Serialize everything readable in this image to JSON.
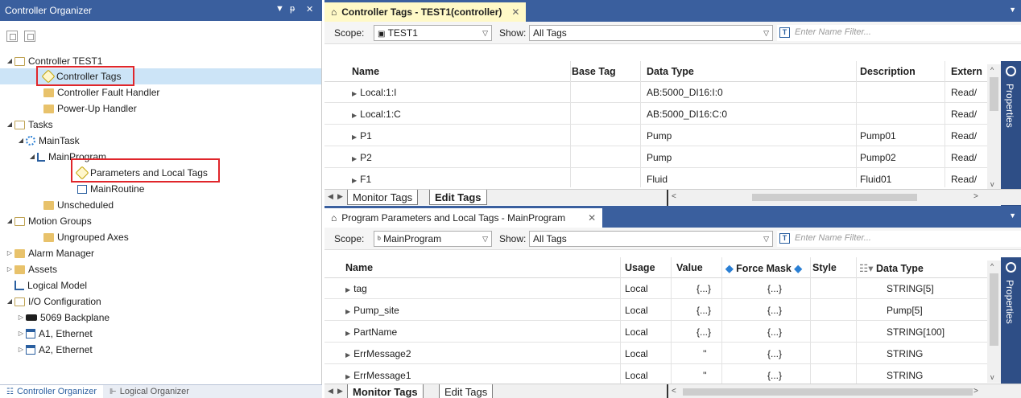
{
  "organizer": {
    "title": "Controller Organizer",
    "pin_glyph": "▾ ᵽ ✕",
    "tree": [
      {
        "label": "Controller TEST1",
        "icon": "folder-open-icon",
        "expand": "◢"
      },
      {
        "label": "Controller Tags",
        "icon": "tag-icon",
        "expand": ""
      },
      {
        "label": "Controller Fault Handler",
        "icon": "folder-icon",
        "expand": ""
      },
      {
        "label": "Power-Up Handler",
        "icon": "folder-icon",
        "expand": ""
      },
      {
        "label": "Tasks",
        "icon": "folder-open-icon",
        "expand": "◢"
      },
      {
        "label": "MainTask",
        "icon": "sync-icon",
        "expand": "◢"
      },
      {
        "label": "MainProgram",
        "icon": "program-icon",
        "expand": "◢"
      },
      {
        "label": "Parameters and Local Tags",
        "icon": "tag-icon",
        "expand": ""
      },
      {
        "label": "MainRoutine",
        "icon": "routine-icon",
        "expand": ""
      },
      {
        "label": "Unscheduled",
        "icon": "folder-icon",
        "expand": ""
      },
      {
        "label": "Motion Groups",
        "icon": "folder-open-icon",
        "expand": "◢"
      },
      {
        "label": "Ungrouped Axes",
        "icon": "folder-icon",
        "expand": ""
      },
      {
        "label": "Alarm Manager",
        "icon": "folder-icon",
        "expand": "▷"
      },
      {
        "label": "Assets",
        "icon": "folder-icon",
        "expand": "▷"
      },
      {
        "label": "Logical Model",
        "icon": "logical-model-icon",
        "expand": ""
      },
      {
        "label": "I/O Configuration",
        "icon": "folder-open-icon",
        "expand": "◢"
      },
      {
        "label": "5069 Backplane",
        "icon": "backplane-icon",
        "expand": "▷"
      },
      {
        "label": "A1, Ethernet",
        "icon": "ethernet-icon",
        "expand": "▷"
      },
      {
        "label": "A2, Ethernet",
        "icon": "ethernet-icon",
        "expand": "▷"
      }
    ],
    "bottom_tabs": [
      "Controller Organizer",
      "Logical Organizer"
    ]
  },
  "top_panel": {
    "tab_label": "Controller Tags - TEST1(controller)",
    "scope_label": "Scope:",
    "scope_value": "TEST1",
    "show_label": "Show:",
    "show_value": "All Tags",
    "filter_placeholder": "Enter Name Filter...",
    "columns": [
      "Name",
      "Base Tag",
      "Data Type",
      "Description",
      "Extern"
    ],
    "rows": [
      {
        "name": "Local:1:I",
        "base": "",
        "type": "AB:5000_DI16:I:0",
        "desc": "",
        "ext": "Read/"
      },
      {
        "name": "Local:1:C",
        "base": "",
        "type": "AB:5000_DI16:C:0",
        "desc": "",
        "ext": "Read/"
      },
      {
        "name": "P1",
        "base": "",
        "type": "Pump",
        "desc": "Pump01",
        "ext": "Read/"
      },
      {
        "name": "P2",
        "base": "",
        "type": "Pump",
        "desc": "Pump02",
        "ext": "Read/"
      },
      {
        "name": "F1",
        "base": "",
        "type": "Fluid",
        "desc": "Fluid01",
        "ext": "Read/"
      }
    ],
    "sheet_tabs": [
      "Monitor Tags",
      "Edit Tags"
    ],
    "properties_label": "Properties"
  },
  "bottom_panel": {
    "tab_label": "Program Parameters and Local Tags - MainProgram",
    "scope_label": "Scope:",
    "scope_value": "MainProgram",
    "show_label": "Show:",
    "show_value": "All Tags",
    "filter_placeholder": "Enter Name Filter...",
    "columns": [
      "Name",
      "Usage",
      "Value",
      "Force Mask",
      "Style",
      "Data Type"
    ],
    "rows": [
      {
        "name": "tag",
        "usage": "Local",
        "value": "{...}",
        "force": "{...}",
        "style": "",
        "type": "STRING[5]"
      },
      {
        "name": "Pump_site",
        "usage": "Local",
        "value": "{...}",
        "force": "{...}",
        "style": "",
        "type": "Pump[5]"
      },
      {
        "name": "PartName",
        "usage": "Local",
        "value": "{...}",
        "force": "{...}",
        "style": "",
        "type": "STRING[100]"
      },
      {
        "name": "ErrMessage2",
        "usage": "Local",
        "value": "''",
        "force": "{...}",
        "style": "",
        "type": "STRING"
      },
      {
        "name": "ErrMessage1",
        "usage": "Local",
        "value": "''",
        "force": "{...}",
        "style": "",
        "type": "STRING"
      }
    ],
    "sheet_tabs": [
      "Monitor Tags",
      "Edit Tags"
    ],
    "properties_label": "Properties"
  },
  "colors": {
    "titlebar": "#3a5f9e",
    "active_tab": "#fff9c7",
    "selection": "#cce4f7",
    "highlight_box": "#e0262b"
  }
}
